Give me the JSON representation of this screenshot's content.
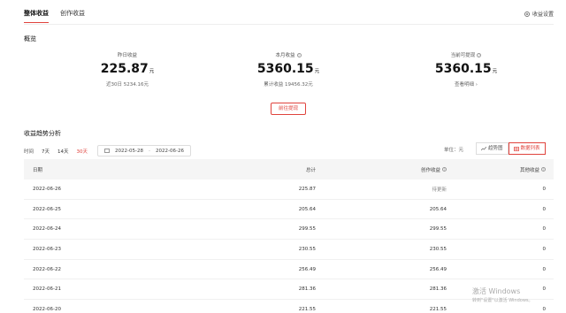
{
  "tabs": [
    {
      "label": "整体收益",
      "active": true
    },
    {
      "label": "创作收益",
      "active": false
    }
  ],
  "header": {
    "settings_label": "收益设置"
  },
  "overview": {
    "title": "概览",
    "yesterday": {
      "label": "昨日收益",
      "value": "225.87",
      "unit": "元",
      "sub": "近30日 5234.16元"
    },
    "month": {
      "label": "本月收益",
      "value": "5360.15",
      "unit": "元",
      "sub": "累计收益 19456.32元"
    },
    "withdrawable": {
      "label": "当前可提现",
      "value": "5360.15",
      "unit": "元",
      "sub": "查看明细 ›"
    },
    "withdraw_button": "前往提现"
  },
  "trend": {
    "title": "收益趋势分析",
    "time_label": "时间",
    "periods": [
      "7天",
      "14天",
      "30天"
    ],
    "active_period": "30天",
    "start_date": "2022-05-28",
    "date_sep": "-",
    "end_date": "2022-06-26",
    "unit_label": "单位：元",
    "view_trend": "趋势图",
    "view_list": "数据列表"
  },
  "table": {
    "headers": {
      "date": "日期",
      "total": "总计",
      "creation": "创作收益",
      "other": "其他收益"
    },
    "rows": [
      {
        "date": "2022-06-26",
        "total": "225.87",
        "creation": "待更新",
        "other": "0"
      },
      {
        "date": "2022-06-25",
        "total": "205.64",
        "creation": "205.64",
        "other": "0"
      },
      {
        "date": "2022-06-24",
        "total": "299.55",
        "creation": "299.55",
        "other": "0"
      },
      {
        "date": "2022-06-23",
        "total": "230.55",
        "creation": "230.55",
        "other": "0"
      },
      {
        "date": "2022-06-22",
        "total": "256.49",
        "creation": "256.49",
        "other": "0"
      },
      {
        "date": "2022-06-21",
        "total": "281.36",
        "creation": "281.36",
        "other": "0"
      },
      {
        "date": "2022-06-20",
        "total": "221.55",
        "creation": "221.55",
        "other": "0"
      }
    ]
  },
  "watermark": {
    "line1": "激活 Windows",
    "line2": "转到\"设置\"以激活 Windows。"
  },
  "colors": {
    "accent": "#e0433d"
  }
}
